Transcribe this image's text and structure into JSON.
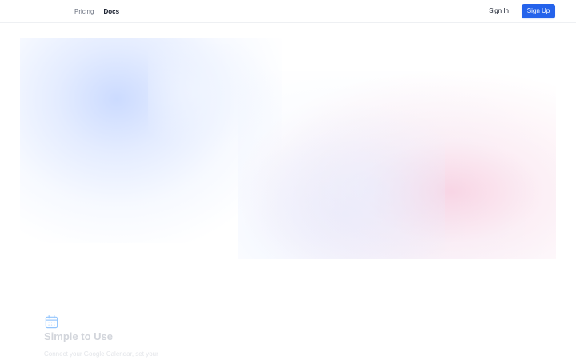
{
  "header": {
    "nav_items": [
      {
        "label": "Pricing"
      },
      {
        "label": "Docs"
      }
    ],
    "signin_label": "Sign In",
    "signup_label": "Sign Up"
  },
  "feature": {
    "icon": "calendar-icon",
    "title": "Simple to Use",
    "description": "Connect your Google Calendar, set your"
  },
  "colors": {
    "accent": "#2563eb",
    "page_background": "#ffffff",
    "muted_text": "#6b7280",
    "hero_blue_glow": "#d8e4ff",
    "hero_pink_glow": "#f8d3e3"
  }
}
